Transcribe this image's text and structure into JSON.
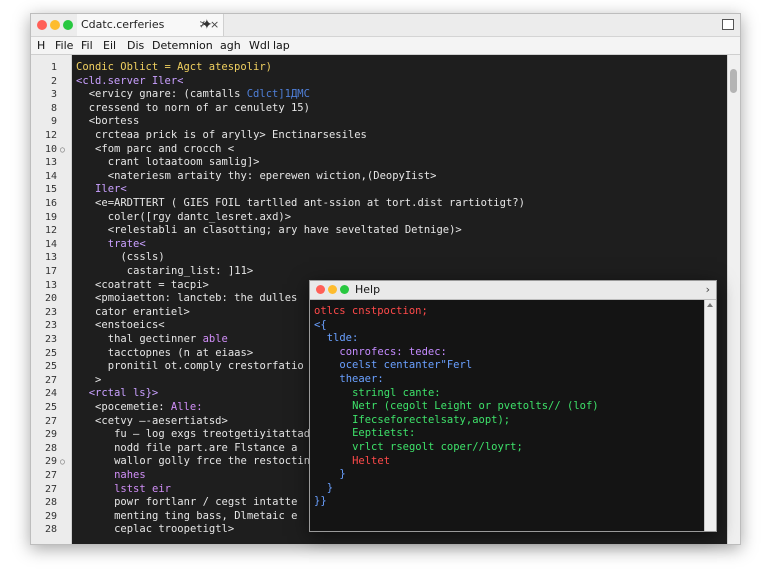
{
  "tab": {
    "title": "Cdatc.cerferies",
    "pin": "≯",
    "close": "×",
    "new": "✦"
  },
  "menu": [
    "H",
    "File",
    "Fil",
    "Eil",
    "Dis",
    "Detemnion",
    "agh",
    "Wdl",
    "lap"
  ],
  "lines": [
    {
      "n": "1",
      "indent": 0,
      "text": "Condic Oblict = Agct atespolir)",
      "color": "#f0d060"
    },
    {
      "n": "2",
      "indent": 0,
      "text": "<cld.server Iler<",
      "color": "#c9a0ff"
    },
    {
      "n": "3",
      "indent": 2,
      "text": "<ervicy gnare: (camtalls",
      "color": "#e6e6e6",
      "extra": " Cdlct]1ДMC",
      "extra_color": "#4f7fd8"
    },
    {
      "n": "8",
      "indent": 2,
      "text": "cressend to norn of ar cenulety 15)",
      "color": "#e6e6e6"
    },
    {
      "n": "9",
      "indent": 2,
      "text": "<bortess",
      "color": "#e6e6e6"
    },
    {
      "n": "12",
      "indent": 3,
      "text": "crcteaa prick is of arylly> Enctinarsesiles",
      "color": "#e6e6e6"
    },
    {
      "n": "10",
      "indent": 3,
      "text": "<fom parc and crocch <",
      "color": "#e6e6e6"
    },
    {
      "n": "13",
      "indent": 5,
      "text": "crant lotaatoom samlig]>",
      "color": "#e6e6e6"
    },
    {
      "n": "14",
      "indent": 5,
      "text": "<nateriesm artaity thy: eperewen wiction,(DeopyIist>",
      "color": "#e6e6e6"
    },
    {
      "n": "15",
      "indent": 3,
      "text": "Iler<",
      "color": "#c9a0ff"
    },
    {
      "n": "16",
      "indent": 3,
      "text": "<e=ARDTTERT ( GIES FOIL tartlled ant-ssion at tort.dist rartiotigt?)",
      "color": "#e6e6e6"
    },
    {
      "n": "19",
      "indent": 5,
      "text": "coler([rgy dantc_lesret.axd)>",
      "color": "#e6e6e6"
    },
    {
      "n": "12",
      "indent": 5,
      "text": "<relestabli an clasotting; ary have seveltated Detnige)>",
      "color": "#e6e6e6"
    },
    {
      "n": "14",
      "indent": 5,
      "text": "trate<",
      "color": "#c9a0ff"
    },
    {
      "n": "13",
      "indent": 7,
      "text": "(cssls)",
      "color": "#e6e6e6"
    },
    {
      "n": "17",
      "indent": 8,
      "text": "castaring_list: ]11>",
      "color": "#e6e6e6"
    },
    {
      "n": "13",
      "indent": 3,
      "text": "<coatratt = tacpi>",
      "color": "#e6e6e6"
    },
    {
      "n": "20",
      "indent": 3,
      "text": "<pmoiaetton: lancteb: the dulles",
      "color": "#e6e6e6"
    },
    {
      "n": "23",
      "indent": 3,
      "text": "cator erantiel>",
      "color": "#e6e6e6"
    },
    {
      "n": "23",
      "indent": 3,
      "text": "<enstoeics<",
      "color": "#e6e6e6"
    },
    {
      "n": "23",
      "indent": 5,
      "text": "thal gectinner able",
      "color": "#e6e6e6",
      "highlight": "able",
      "highlight_color": "#d08ef7"
    },
    {
      "n": "25",
      "indent": 5,
      "text": "tacctopnes (n at eiaas>",
      "color": "#e6e6e6"
    },
    {
      "n": "25",
      "indent": 5,
      "text": "pronitil ot.comply crestorfatio",
      "color": "#e6e6e6"
    },
    {
      "n": "27",
      "indent": 3,
      "text": ">",
      "color": "#e6e6e6"
    },
    {
      "n": "24",
      "indent": 2,
      "text": "<rctal ls}>",
      "color": "#c9a0ff"
    },
    {
      "n": "25",
      "indent": 3,
      "text": "<pocemetie: Alle:",
      "color": "#e6e6e6",
      "highlight": "Alle:",
      "highlight_color": "#d08ef7"
    },
    {
      "n": "27",
      "indent": 3,
      "text": "<cetvy —-aesertiatsd>",
      "color": "#e6e6e6"
    },
    {
      "n": "29",
      "indent": 6,
      "text": "fu — log exgs treotgetiyitattad",
      "color": "#e6e6e6"
    },
    {
      "n": "28",
      "indent": 6,
      "text": "nodd file part.are Flstance a",
      "color": "#e6e6e6"
    },
    {
      "n": "29",
      "indent": 6,
      "text": "wallor golly frce the restoctin",
      "color": "#e6e6e6"
    },
    {
      "n": "27",
      "indent": 6,
      "text": "nahes",
      "color": "#d08ef7"
    },
    {
      "n": "27",
      "indent": 6,
      "text": "lstst eir",
      "color": "#d08ef7"
    },
    {
      "n": "28",
      "indent": 6,
      "text": "powr fortlanr / cegst intatte",
      "color": "#e6e6e6"
    },
    {
      "n": "29",
      "indent": 6,
      "text": "menting ting bass, Dlmetaic e",
      "color": "#e6e6e6"
    },
    {
      "n": "28",
      "indent": 6,
      "text": "ceplac troopetigtl>",
      "color": "#e6e6e6"
    }
  ],
  "help": {
    "title": "Help",
    "chev": "›",
    "lines": [
      {
        "indent": 0,
        "text": "otlcs cnstpoction;",
        "color": "#ff4a4a"
      },
      {
        "indent": 0,
        "text": "<{",
        "color": "#6aa0ff"
      },
      {
        "indent": 2,
        "text": "tlde:",
        "color": "#6aa0ff"
      },
      {
        "indent": 4,
        "text": "conrofecs: tedec:",
        "color": "#c48bff"
      },
      {
        "indent": 4,
        "text": "ocelst centanter\"Ferl",
        "color": "#6aa0ff"
      },
      {
        "indent": 4,
        "text": "theaer:",
        "color": "#6aa0ff"
      },
      {
        "indent": 6,
        "text": "stringl cante:",
        "color": "#3ee26a"
      },
      {
        "indent": 6,
        "text": "Netr (cegolt Leight or pvetolts// (lof)",
        "color": "#3ee26a"
      },
      {
        "indent": 6,
        "text": "Ifecseforectelsaty,aopt);",
        "color": "#3ee26a"
      },
      {
        "indent": 6,
        "text": "Eeptietst:",
        "color": "#3ee26a"
      },
      {
        "indent": 6,
        "text": "vrlct rsegolt coper//loyrt;",
        "color": "#3ee26a"
      },
      {
        "indent": 6,
        "text": "Heltet",
        "color": "#ff4a4a"
      },
      {
        "indent": 4,
        "text": "}",
        "color": "#6aa0ff"
      },
      {
        "indent": 2,
        "text": "}",
        "color": "#6aa0ff"
      },
      {
        "indent": 0,
        "text": "}}",
        "color": "#6aa0ff"
      }
    ]
  }
}
